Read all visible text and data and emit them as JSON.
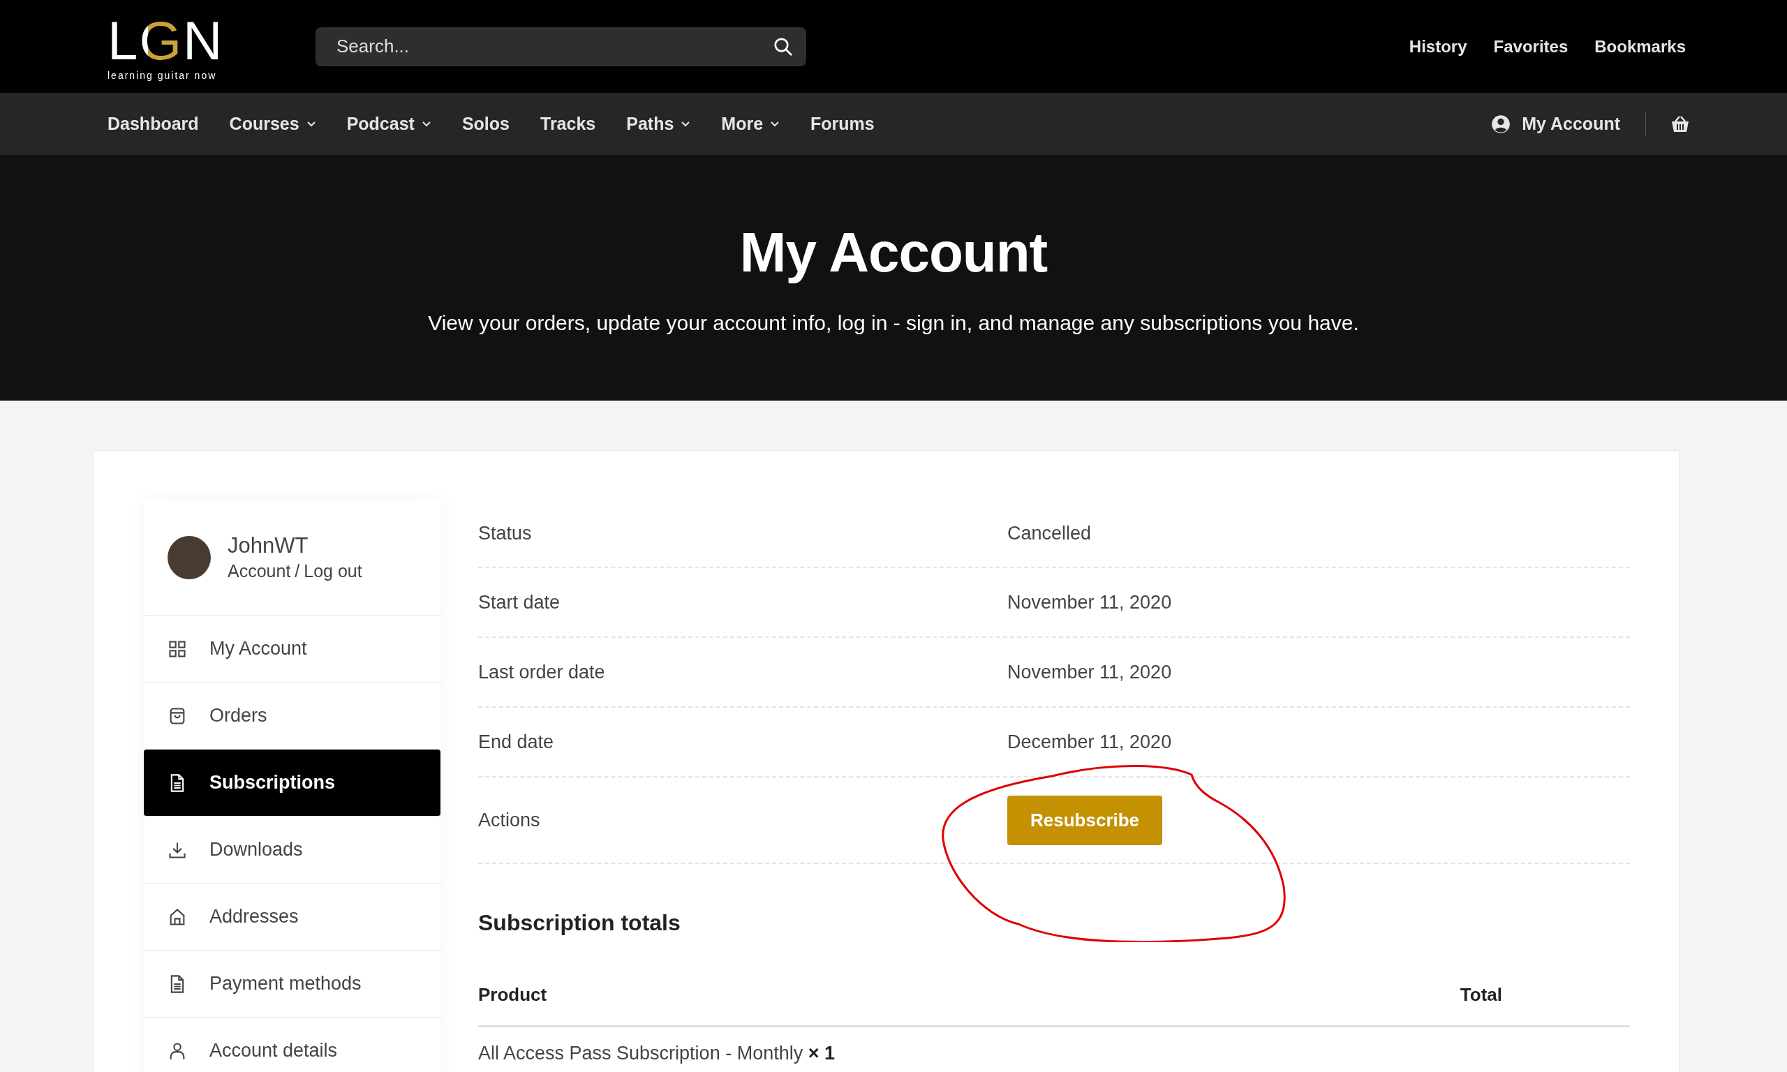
{
  "logo": {
    "letters": "LGN",
    "tagline": "learning guitar now"
  },
  "search": {
    "placeholder": "Search..."
  },
  "top_links": [
    "History",
    "Favorites",
    "Bookmarks"
  ],
  "nav": [
    {
      "label": "Dashboard",
      "dropdown": false
    },
    {
      "label": "Courses",
      "dropdown": true
    },
    {
      "label": "Podcast",
      "dropdown": true
    },
    {
      "label": "Solos",
      "dropdown": false
    },
    {
      "label": "Tracks",
      "dropdown": false
    },
    {
      "label": "Paths",
      "dropdown": true
    },
    {
      "label": "More",
      "dropdown": true
    },
    {
      "label": "Forums",
      "dropdown": false
    }
  ],
  "account_link": "My Account",
  "hero": {
    "title": "My Account",
    "subtitle": "View your orders, update your account info, log in - sign in, and manage any subscriptions you have."
  },
  "profile": {
    "name": "JohnWT",
    "account_link": "Account",
    "separator": "/",
    "logout_link": "Log out"
  },
  "sidebar": {
    "items": [
      {
        "label": "My Account",
        "kind": "grid",
        "selected": false
      },
      {
        "label": "Orders",
        "kind": "bag",
        "selected": false
      },
      {
        "label": "Subscriptions",
        "kind": "document",
        "selected": true
      },
      {
        "label": "Downloads",
        "kind": "download",
        "selected": false
      },
      {
        "label": "Addresses",
        "kind": "home",
        "selected": false
      },
      {
        "label": "Payment methods",
        "kind": "document",
        "selected": false
      },
      {
        "label": "Account details",
        "kind": "user",
        "selected": false
      }
    ]
  },
  "details": [
    {
      "label": "Status",
      "value": "Cancelled"
    },
    {
      "label": "Start date",
      "value": "November 11, 2020"
    },
    {
      "label": "Last order date",
      "value": "November 11, 2020"
    },
    {
      "label": "End date",
      "value": "December 11, 2020"
    }
  ],
  "actions": {
    "label": "Actions",
    "button": "Resubscribe"
  },
  "totals": {
    "heading": "Subscription totals",
    "columns": [
      "Product",
      "Total"
    ],
    "rows": [
      {
        "product": "All Access Pass Subscription - Monthly",
        "quantity": "× 1"
      }
    ]
  }
}
